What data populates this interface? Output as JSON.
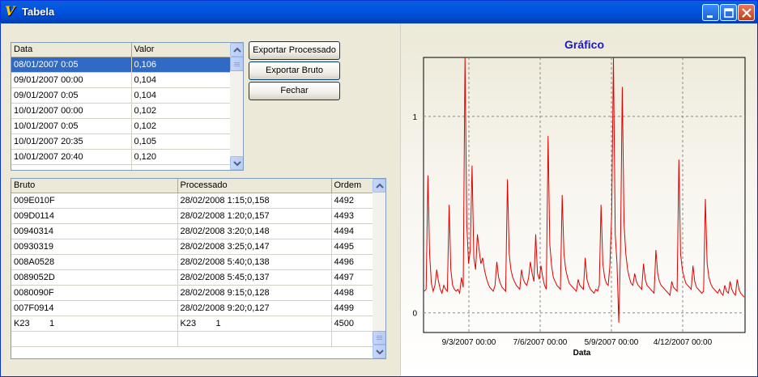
{
  "window": {
    "title": "Tabela"
  },
  "top_table": {
    "columns": [
      "Data",
      "Valor"
    ],
    "rows": [
      [
        "08/01/2007 0:05",
        "0,106"
      ],
      [
        "09/01/2007 00:00",
        "0,104"
      ],
      [
        "09/01/2007 0:05",
        "0,104"
      ],
      [
        "10/01/2007 00:00",
        "0,102"
      ],
      [
        "10/01/2007 0:05",
        "0,102"
      ],
      [
        "10/01/2007 20:35",
        "0,105"
      ],
      [
        "10/01/2007 20:40",
        "0,120"
      ]
    ]
  },
  "buttons": {
    "export_processed": "Exportar Processado",
    "export_raw": "Exportar Bruto",
    "close": "Fechar"
  },
  "bottom_table": {
    "columns": [
      "Bruto",
      "Processado",
      "Ordem"
    ],
    "rows": [
      [
        "009E010F",
        "28/02/2008 1:15;0,158",
        "4492"
      ],
      [
        "009D0114",
        "28/02/2008 1:20;0,157",
        "4493"
      ],
      [
        "00940314",
        "28/02/2008 3:20;0,148",
        "4494"
      ],
      [
        "00930319",
        "28/02/2008 3:25;0,147",
        "4495"
      ],
      [
        "008A0528",
        "28/02/2008 5:40;0,138",
        "4496"
      ],
      [
        "0089052D",
        "28/02/2008 5:45;0,137",
        "4497"
      ],
      [
        "0080090F",
        "28/02/2008 9:15;0,128",
        "4498"
      ],
      [
        "007F0914",
        "28/02/2008 9:20;0,127",
        "4499"
      ],
      [
        "K23        1",
        "K23        1",
        "4500"
      ]
    ]
  },
  "chart_data": {
    "type": "line",
    "title": "Gráfico",
    "xlabel": "Data",
    "ylabel": "",
    "x_tick_labels": [
      "9/3/2007 00:00",
      "7/6/2007 00:00",
      "5/9/2007 00:00",
      "4/12/2007 00:00"
    ],
    "y_tick_labels": [
      "0",
      "1"
    ],
    "ylim": [
      -0.1,
      1.3
    ],
    "grid": true,
    "line_color": "#e00000",
    "title_color": "#1a1acc",
    "series": [
      {
        "values": [
          0.11,
          0.12,
          0.7,
          0.3,
          0.15,
          0.11,
          0.14,
          0.22,
          0.16,
          0.12,
          0.1,
          0.14,
          0.12,
          0.11,
          0.55,
          0.22,
          0.14,
          0.12,
          0.11,
          0.12,
          0.1,
          0.18,
          0.13,
          1.3,
          0.45,
          0.25,
          0.32,
          0.75,
          0.28,
          0.22,
          0.4,
          0.32,
          0.25,
          0.28,
          0.22,
          0.18,
          0.15,
          0.13,
          0.12,
          0.11,
          0.14,
          0.26,
          0.18,
          0.15,
          0.13,
          0.12,
          0.11,
          0.68,
          0.3,
          0.22,
          0.18,
          0.16,
          0.14,
          0.13,
          0.12,
          0.22,
          0.17,
          0.15,
          0.14,
          0.18,
          0.26,
          0.2,
          0.16,
          0.4,
          0.2,
          0.17,
          0.24,
          0.18,
          0.14,
          0.12,
          0.9,
          0.35,
          0.24,
          0.18,
          0.16,
          0.14,
          0.13,
          0.12,
          0.6,
          0.3,
          0.22,
          0.18,
          0.15,
          0.14,
          0.13,
          0.12,
          0.11,
          0.17,
          0.14,
          0.13,
          0.12,
          0.28,
          0.17,
          0.14,
          0.12,
          0.11,
          0.1,
          0.12,
          0.11,
          0.14,
          0.55,
          0.25,
          0.18,
          0.15,
          0.14,
          0.24,
          0.5,
          1.35,
          0.4,
          0.25,
          -0.05,
          0.32,
          1.15,
          0.45,
          0.3,
          0.22,
          0.18,
          0.15,
          0.14,
          0.2,
          0.16,
          0.14,
          0.13,
          0.12,
          0.25,
          0.17,
          0.14,
          0.13,
          0.12,
          0.11,
          0.1,
          0.32,
          0.2,
          0.16,
          0.14,
          0.13,
          0.12,
          0.11,
          0.1,
          0.09,
          0.16,
          0.13,
          0.12,
          0.11,
          0.78,
          0.3,
          0.22,
          0.18,
          0.15,
          0.14,
          0.13,
          0.12,
          0.24,
          0.16,
          0.13,
          0.12,
          0.11,
          0.1,
          0.11,
          0.58,
          0.25,
          0.18,
          0.15,
          0.13,
          0.12,
          0.11,
          0.1,
          0.12,
          0.1,
          0.09,
          0.14,
          0.11,
          0.1,
          0.16,
          0.12,
          0.1,
          0.09,
          0.17,
          0.12,
          0.1,
          0.09,
          0.08
        ]
      }
    ]
  }
}
